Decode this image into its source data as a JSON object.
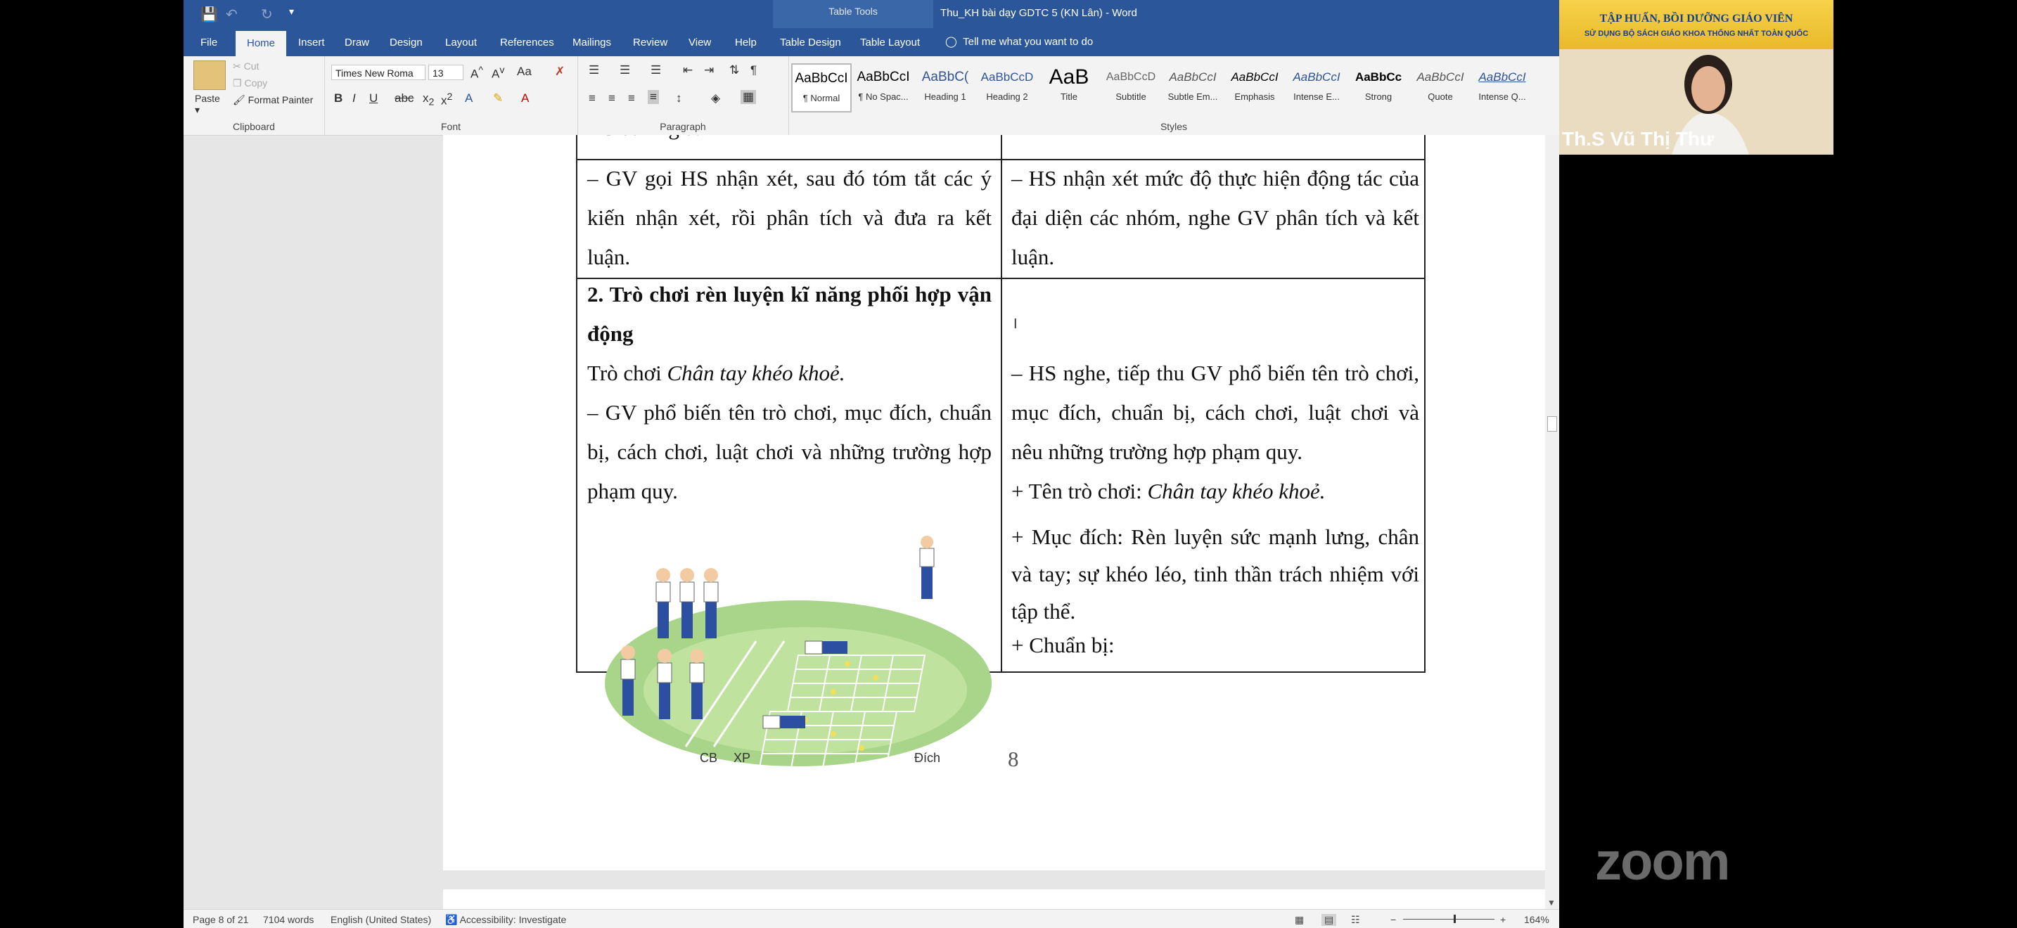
{
  "window": {
    "doc_title": "Thu_KH bài dạy GDTC 5 (KN Lân) - Word",
    "table_tools_label": "Table Tools"
  },
  "tabs": [
    "File",
    "Home",
    "Insert",
    "Draw",
    "Design",
    "Layout",
    "References",
    "Mailings",
    "Review",
    "View",
    "Help",
    "Table Design",
    "Table Layout"
  ],
  "tell_me": "Tell me what you want to do",
  "ribbon": {
    "clipboard": {
      "label": "Clipboard",
      "paste": "Paste",
      "cut": "Cut",
      "copy": "Copy",
      "format_painter": "Format Painter"
    },
    "font": {
      "label": "Font",
      "font_name": "Times New Roma",
      "font_size": "13"
    },
    "paragraph": {
      "label": "Paragraph"
    },
    "styles": {
      "label": "Styles",
      "items": [
        {
          "preview": "AaBbCcI",
          "name": "¶ Normal"
        },
        {
          "preview": "AaBbCcI",
          "name": "¶ No Spac..."
        },
        {
          "preview": "AaBbC(",
          "name": "Heading 1"
        },
        {
          "preview": "AaBbCcD",
          "name": "Heading 2"
        },
        {
          "preview": "AaB",
          "name": "Title"
        },
        {
          "preview": "AaBbCcD",
          "name": "Subtitle"
        },
        {
          "preview": "AaBbCcI",
          "name": "Subtle Em..."
        },
        {
          "preview": "AaBbCcI",
          "name": "Emphasis"
        },
        {
          "preview": "AaBbCcI",
          "name": "Intense E..."
        },
        {
          "preview": "AaBbCc",
          "name": "Strong"
        },
        {
          "preview": "AaBbCcI",
          "name": "Quote"
        },
        {
          "preview": "AaBbCcI",
          "name": "Intense Q..."
        }
      ]
    }
  },
  "document": {
    "top_fragment": "HS đánh giá.",
    "row1_left": "– GV gọi HS nhận xét, sau đó tóm tắt các ý kiến nhận xét, rồi phân tích và đưa ra kết luận.",
    "row1_right": "– HS nhận xét mức độ thực hiện động tác của đại diện các nhóm, nghe GV phân tích và kết luận.",
    "row2_heading": "2. Trò chơi rèn luyện kĩ năng phối hợp vận động",
    "game_prefix": "Trò chơi ",
    "game_name": "Chân tay khéo khoẻ.",
    "gv_text": "– GV phổ biến tên trò chơi, mục đích, chuẩn bị, cách chơi, luật chơi và những trường hợp phạm quy.",
    "hs_text": "– HS nghe, tiếp thu GV phổ biến tên trò chơi, mục đích, chuẩn bị, cách chơi, luật chơi và nêu những trường hợp phạm quy.",
    "ten_prefix": "+ Tên trò chơi: ",
    "ten_name": "Chân tay khéo khoẻ.",
    "muc_dich": "+ Mục đích: Rèn luyện sức mạnh lưng, chân và tay; sự khéo léo, tinh thần trách nhiệm với tập thể.",
    "chuan_bi": "+ Chuẩn bị:",
    "image_labels": {
      "cb": "CB",
      "xp": "XP",
      "dich": "Đích"
    },
    "page_number": "8"
  },
  "statusbar": {
    "page": "Page 8 of 21",
    "words": "7104 words",
    "language": "English (United States)",
    "accessibility": "Accessibility: Investigate",
    "zoom": "164%"
  },
  "video": {
    "banner_line1": "TẬP HUẤN, BỒI DƯỠNG GIÁO VIÊN",
    "banner_line2": "SỬ DỤNG BỘ SÁCH GIÁO KHOA THỐNG NHẤT TOÀN QUỐC",
    "name": "Th.S Vũ Thị Thư"
  },
  "zoom_logo": "zoom"
}
